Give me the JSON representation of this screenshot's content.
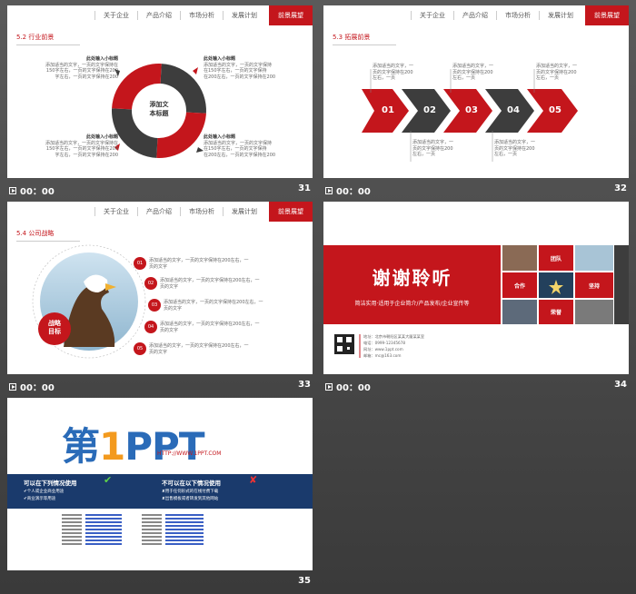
{
  "nav": {
    "items": [
      "关于企业",
      "产品介绍",
      "市场分析",
      "发展计划"
    ],
    "active": "前景展望"
  },
  "time": "00：00",
  "slides": {
    "s31": {
      "num": "31",
      "section": "5.2 行业前景",
      "center": "添加文\n本标题",
      "blocks": [
        {
          "title": "此处输入小标题",
          "body": "添加适当的文字，一页的文字保持在\n150字左右，一页的文字保持在200\n字左右，一页的文字保持在200"
        },
        {
          "title": "此处输入小标题",
          "body": "添加适当的文字，一页的文字保持\n在150字左右，一页的文字保持\n在200左右，一页的文字保持在200"
        }
      ]
    },
    "s32": {
      "num": "32",
      "section": "5.3 拓展前景",
      "steps": [
        "01",
        "02",
        "03",
        "04",
        "05"
      ],
      "note": "添加适当的文字，一页的文字保持在200左右，一页"
    },
    "s33": {
      "num": "33",
      "section": "5.4 公司战略",
      "badge": "战略\n目标",
      "steps": [
        "01",
        "02",
        "03",
        "04",
        "05"
      ],
      "note": "添加适当的文字，一页的文字保持在200左右，一页的文字"
    },
    "s34": {
      "num": "34",
      "title": "谢谢聆听",
      "subtitle": "简洁实用·适用于企业简介/产品发布/企业宣传等",
      "tiles": [
        "团队",
        "合作",
        "坚持",
        "荣誉"
      ],
      "contact": [
        "地址：北京市朝阳区某某大厦某某室",
        "电话：0999-12345678",
        "网址：www.1ppt.com",
        "邮箱：mc@163.com"
      ]
    },
    "s35": {
      "num": "35",
      "logo_main": "第",
      "logo_one": "1",
      "logo_rest": "PPT",
      "url": "HTTP://WWW.1PPT.COM",
      "can_title": "可以在下列情况使用",
      "cannot_title": "不可以在以下情况使用",
      "can_items": [
        "✔个人或企业商业用途",
        "✔商业演示等用途"
      ],
      "cannot_items": [
        "✘用于任何形式的在线付费下载",
        "✘出售模板或者转发到其他网站"
      ]
    }
  },
  "colors": {
    "accent": "#c4161c",
    "dark": "#3d3d3d",
    "navy": "#1a3a6c"
  }
}
